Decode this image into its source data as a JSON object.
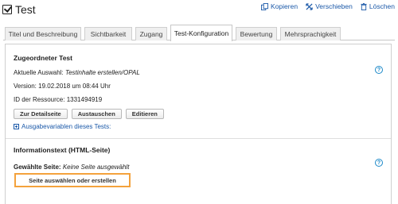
{
  "header": {
    "title": "Test",
    "actions": [
      {
        "label": "Kopieren",
        "icon": "copy-icon"
      },
      {
        "label": "Verschieben",
        "icon": "move-icon"
      },
      {
        "label": "Löschen",
        "icon": "trash-icon"
      }
    ]
  },
  "tabs": [
    {
      "label": "Titel und Beschreibung"
    },
    {
      "label": "Sichtbarkeit"
    },
    {
      "label": "Zugang"
    },
    {
      "label": "Test-Konfiguration",
      "active": true
    },
    {
      "label": "Bewertung"
    },
    {
      "label": "Mehrsprachigkeit"
    }
  ],
  "test_section": {
    "title": "Zugeordneter Test",
    "current_label": "Aktuelle Auswahl:",
    "current_value": "Testinhalte erstellen/OPAL",
    "version_label": "Version:",
    "version_value": "19.02.2018 um 08:44 Uhr",
    "resource_label": "ID der Ressource:",
    "resource_value": "1331494919",
    "buttons": {
      "details": "Zur Detailseite",
      "replace": "Austauschen",
      "edit": "Editieren"
    },
    "output_link": "Ausgabevariablen dieses Tests:",
    "help": "?"
  },
  "info_section": {
    "title": "Informationstext (HTML-Seite)",
    "selected_label": "Gewählte Seite:",
    "selected_value": "Keine Seite ausgewählt",
    "select_button": "Seite auswählen oder erstellen",
    "help": "?"
  },
  "colors": {
    "link": "#1a58a8",
    "help": "#1a88c8",
    "highlight": "#f4a23c"
  }
}
